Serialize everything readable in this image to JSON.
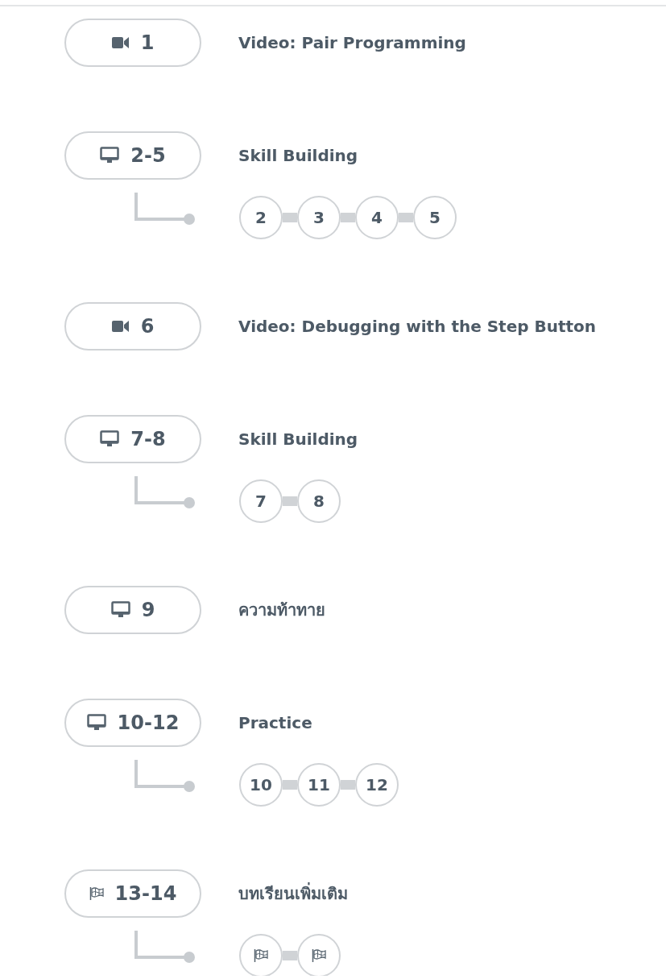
{
  "lessons": [
    {
      "kind": "video",
      "range": "1",
      "title": "Video: Pair Programming"
    },
    {
      "kind": "computer",
      "range": "2-5",
      "title": "Skill Building",
      "bubbles": [
        {
          "kind": "number",
          "label": "2"
        },
        {
          "kind": "number",
          "label": "3"
        },
        {
          "kind": "number",
          "label": "4"
        },
        {
          "kind": "number",
          "label": "5"
        }
      ]
    },
    {
      "kind": "video",
      "range": "6",
      "title": "Video: Debugging with the Step Button"
    },
    {
      "kind": "computer",
      "range": "7-8",
      "title": "Skill Building",
      "bubbles": [
        {
          "kind": "number",
          "label": "7"
        },
        {
          "kind": "number",
          "label": "8"
        }
      ]
    },
    {
      "kind": "computer",
      "range": "9",
      "title": "ความท้าทาย"
    },
    {
      "kind": "computer",
      "range": "10-12",
      "title": "Practice",
      "bubbles": [
        {
          "kind": "number",
          "label": "10"
        },
        {
          "kind": "number",
          "label": "11"
        },
        {
          "kind": "number",
          "label": "12"
        }
      ]
    },
    {
      "kind": "flag",
      "range": "13-14",
      "title": "บทเรียนเพิ่มเติม",
      "bubbles": [
        {
          "kind": "flag"
        },
        {
          "kind": "flag"
        }
      ]
    }
  ]
}
